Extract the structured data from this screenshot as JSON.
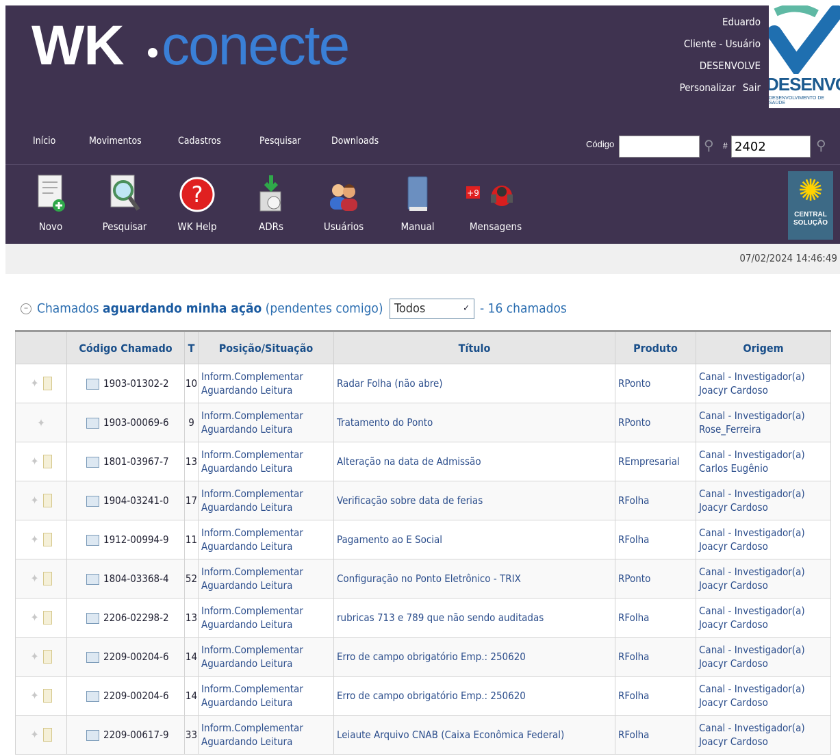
{
  "header": {
    "logo_wk": "WK",
    "logo_conecte": "conecte",
    "user_name": "Eduardo",
    "user_role": "Cliente - Usuário",
    "user_company": "DESENVOLVE",
    "link_personalize": "Personalizar",
    "link_logout": "Sair",
    "company_logo_text": "DESENVOLV",
    "company_logo_sub": "DESENVOLVIMENTO DE SAÚDE"
  },
  "nav": {
    "items": [
      "Início",
      "Movimentos",
      "Cadastros",
      "Pesquisar",
      "Downloads"
    ],
    "code_label": "Código",
    "code_value": "",
    "ticket_value": "2402"
  },
  "toolbar": {
    "tools": [
      "Novo",
      "Pesquisar",
      "WK Help",
      "ADRs",
      "Usuários",
      "Manual",
      "Mensagens"
    ],
    "messages_badge": "+9",
    "central_line1": "CENTRAL",
    "central_line2": "SOLUÇÃO"
  },
  "datetime": "07/02/2024 14:46:49",
  "section": {
    "prefix": "Chamados",
    "bold": "aguardando minha ação",
    "suffix": "(pendentes comigo)",
    "filter_value": "Todos",
    "count": "- 16 chamados"
  },
  "table": {
    "headers": [
      "Código Chamado",
      "T",
      "Posição/Situação",
      "Título",
      "Produto",
      "Origem"
    ],
    "rows": [
      {
        "code": "1903-01302-2",
        "t": "10",
        "pos1": "Inform.Complementar",
        "pos2": "Aguardando Leitura",
        "title": "Radar Folha (não abre)",
        "product": "RPonto",
        "orig1": "Canal - Investigador(a)",
        "orig2": "Joacyr Cardoso"
      },
      {
        "code": "1903-00069-6",
        "t": "9",
        "pos1": "Inform.Complementar",
        "pos2": "Aguardando Leitura",
        "title": "Tratamento do Ponto",
        "product": "RPonto",
        "orig1": "Canal - Investigador(a)",
        "orig2": "Rose_Ferreira"
      },
      {
        "code": "1801-03967-7",
        "t": "13",
        "pos1": "Inform.Complementar",
        "pos2": "Aguardando Leitura",
        "title": "Alteração na data de Admissão",
        "product": "REmpresarial",
        "orig1": "Canal - Investigador(a)",
        "orig2": "Carlos Eugênio"
      },
      {
        "code": "1904-03241-0",
        "t": "17",
        "pos1": "Inform.Complementar",
        "pos2": "Aguardando Leitura",
        "title": "Verificação sobre data de ferias",
        "product": "RFolha",
        "orig1": "Canal - Investigador(a)",
        "orig2": "Joacyr Cardoso"
      },
      {
        "code": "1912-00994-9",
        "t": "11",
        "pos1": "Inform.Complementar",
        "pos2": "Aguardando Leitura",
        "title": "Pagamento ao E Social",
        "product": "RFolha",
        "orig1": "Canal - Investigador(a)",
        "orig2": "Joacyr Cardoso"
      },
      {
        "code": "1804-03368-4",
        "t": "52",
        "pos1": "Inform.Complementar",
        "pos2": "Aguardando Leitura",
        "title": "Configuração no Ponto Eletrônico - TRIX",
        "product": "RPonto",
        "orig1": "Canal - Investigador(a)",
        "orig2": "Joacyr Cardoso"
      },
      {
        "code": "2206-02298-2",
        "t": "13",
        "pos1": "Inform.Complementar",
        "pos2": "Aguardando Leitura",
        "title": "rubricas 713 e 789 que não sendo auditadas",
        "product": "RFolha",
        "orig1": "Canal - Investigador(a)",
        "orig2": "Joacyr Cardoso"
      },
      {
        "code": "2209-00204-6",
        "t": "14",
        "pos1": "Inform.Complementar",
        "pos2": "Aguardando Leitura",
        "title": "Erro de campo obrigatório Emp.: 250620",
        "product": "RFolha",
        "orig1": "Canal - Investigador(a)",
        "orig2": "Joacyr Cardoso"
      },
      {
        "code": "2209-00204-6",
        "t": "14",
        "pos1": "Inform.Complementar",
        "pos2": "Aguardando Leitura",
        "title": "Erro de campo obrigatório Emp.: 250620",
        "product": "RFolha",
        "orig1": "Canal - Investigador(a)",
        "orig2": "Joacyr Cardoso"
      },
      {
        "code": "2209-00617-9",
        "t": "33",
        "pos1": "Inform.Complementar",
        "pos2": "Aguardando Leitura",
        "title": "Leiaute Arquivo CNAB (Caixa Econômica Federal)",
        "product": "RFolha",
        "orig1": "Canal - Investigador(a)",
        "orig2": "Joacyr Cardoso"
      }
    ]
  }
}
